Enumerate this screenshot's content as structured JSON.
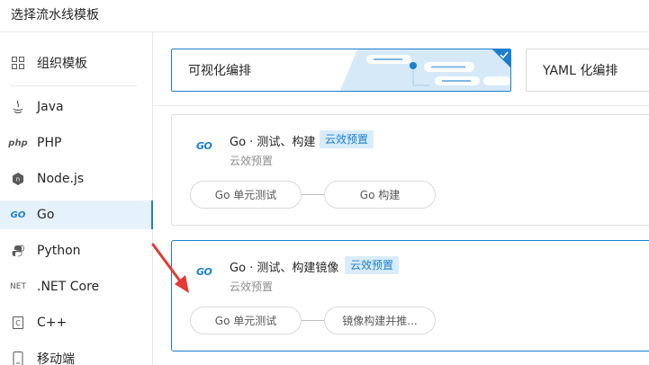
{
  "dialog": {
    "title": "选择流水线模板"
  },
  "sidebar": {
    "items": [
      {
        "label": "组织模板",
        "icon": "grid-icon"
      },
      {
        "label": "Java",
        "icon": "java-icon"
      },
      {
        "label": "PHP",
        "icon": "php-icon",
        "icon_text": "php"
      },
      {
        "label": "Node.js",
        "icon": "nodejs-icon"
      },
      {
        "label": "Go",
        "icon": "go-icon",
        "icon_text": "GO",
        "active": true
      },
      {
        "label": "Python",
        "icon": "python-icon"
      },
      {
        "label": ".NET Core",
        "icon": "dotnet-icon",
        "icon_text": "NET"
      },
      {
        "label": "C++",
        "icon": "cpp-icon",
        "icon_text": "C"
      },
      {
        "label": "移动端",
        "icon": "mobile-icon"
      }
    ]
  },
  "modes": [
    {
      "label": "可视化编排",
      "selected": true
    },
    {
      "label": "YAML 化编排",
      "selected": false
    }
  ],
  "templates": [
    {
      "logo": "GO",
      "name": "Go · 测试、构建",
      "badge": "云效预置",
      "subtitle": "云效预置",
      "stages": [
        "Go 单元测试",
        "Go 构建"
      ]
    },
    {
      "logo": "GO",
      "name": "Go · 测试、构建镜像",
      "badge": "云效预置",
      "subtitle": "云效预置",
      "stages": [
        "Go 单元测试",
        "镜像构建并推..."
      ]
    }
  ],
  "colors": {
    "accent": "#1b7fce",
    "badge_bg": "#d9ecfb",
    "active_bg": "#e6f2fb",
    "annotation": "#e53935"
  }
}
